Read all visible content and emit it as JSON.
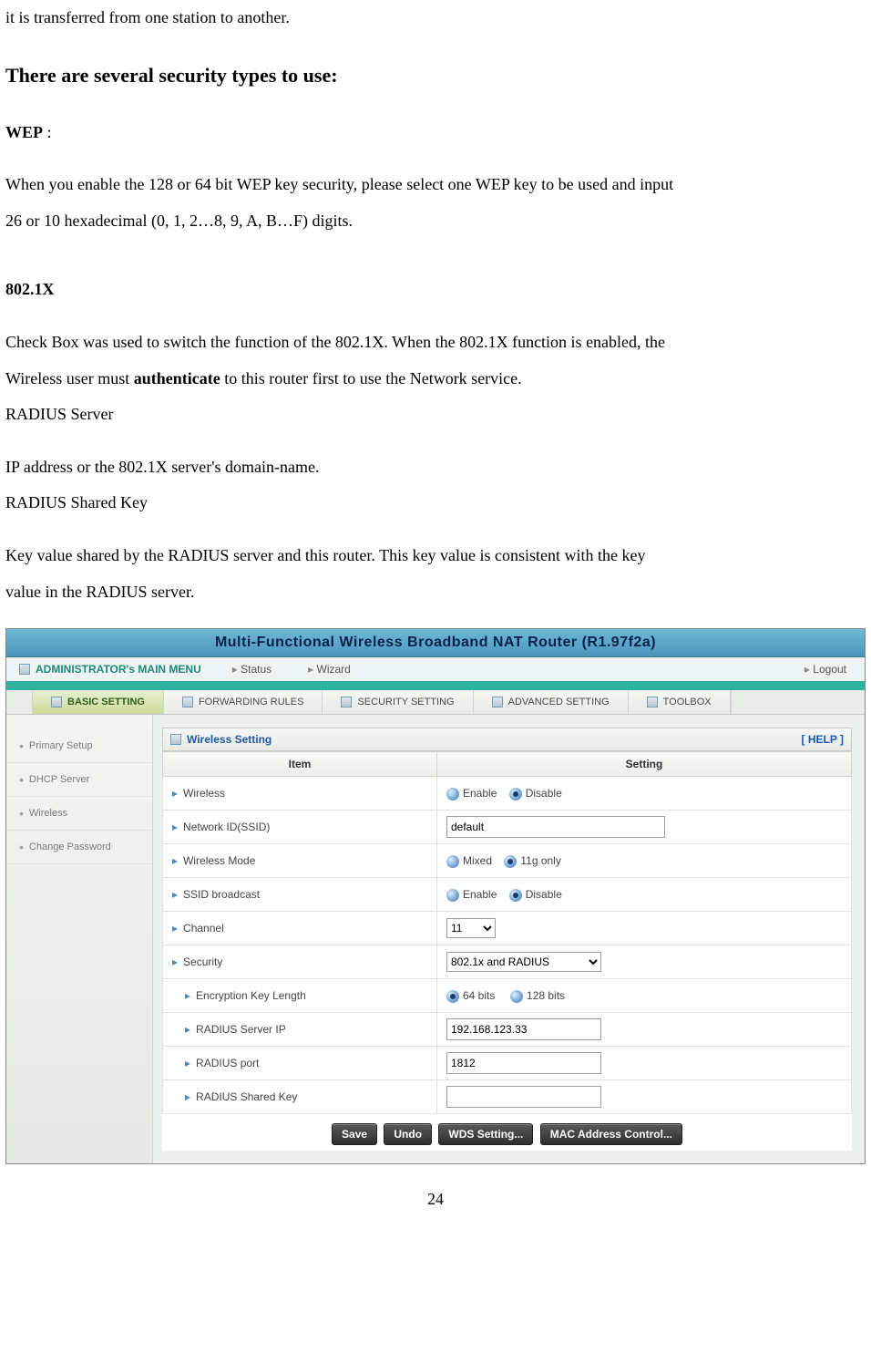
{
  "doc": {
    "line1": "it is transferred from one station to another.",
    "heading": "There are several security types to use:",
    "wep_label": "WEP",
    "wep_colon": " :",
    "wep_p1": "When you enable the 128 or 64 bit WEP key security, please select one WEP key to be used and input",
    "wep_p2": "26 or 10 hexadecimal (0, 1, 2…8, 9, A, B…F) digits.",
    "x_label": "802.1X",
    "x_p1a": "Check Box was used to switch the function of the 802.1X. When the 802.1X function is enabled, the",
    "x_p1b_pre": "Wireless user must ",
    "x_p1b_bold": "authenticate",
    "x_p1b_post": " to this router first to use the Network service.",
    "x_p2": "RADIUS Server",
    "x_p3": "IP address or the 802.1X server's domain-name.",
    "x_p4": "RADIUS Shared Key",
    "x_p5": "Key value shared by the RADIUS server and this router. This key value is consistent with the key",
    "x_p6": "value in the RADIUS server.",
    "page_number": "24"
  },
  "router": {
    "title": "Multi-Functional Wireless Broadband NAT Router (R1.97f2a)",
    "menubar": {
      "admin": "ADMINISTRATOR's MAIN MENU",
      "status": "Status",
      "wizard": "Wizard",
      "logout": "Logout"
    },
    "tabs": {
      "basic": "BASIC SETTING",
      "forwarding": "FORWARDING RULES",
      "security": "SECURITY SETTING",
      "advanced": "ADVANCED SETTING",
      "toolbox": "TOOLBOX"
    },
    "sidebar": [
      "Primary Setup",
      "DHCP Server",
      "Wireless",
      "Change Password"
    ],
    "panel": {
      "title": "Wireless Setting",
      "help": "[ HELP ]",
      "col_item": "Item",
      "col_setting": "Setting",
      "rows": {
        "wireless": "Wireless",
        "ssid": "Network ID(SSID)",
        "mode": "Wireless Mode",
        "broadcast": "SSID broadcast",
        "channel": "Channel",
        "security": "Security",
        "keylen": "Encryption Key Length",
        "radius_ip": "RADIUS Server IP",
        "radius_port": "RADIUS port",
        "radius_key": "RADIUS Shared Key"
      },
      "values": {
        "enable": "Enable",
        "disable": "Disable",
        "ssid_value": "default",
        "mode_mixed": "Mixed",
        "mode_11g": "11g only",
        "channel_value": "11",
        "security_value": "802.1x and RADIUS",
        "bits64": "64 bits",
        "bits128": "128 bits",
        "radius_ip_value": "192.168.123.33",
        "radius_port_value": "1812",
        "radius_key_value": ""
      },
      "buttons": {
        "save": "Save",
        "undo": "Undo",
        "wds": "WDS Setting...",
        "mac": "MAC Address Control..."
      }
    }
  }
}
